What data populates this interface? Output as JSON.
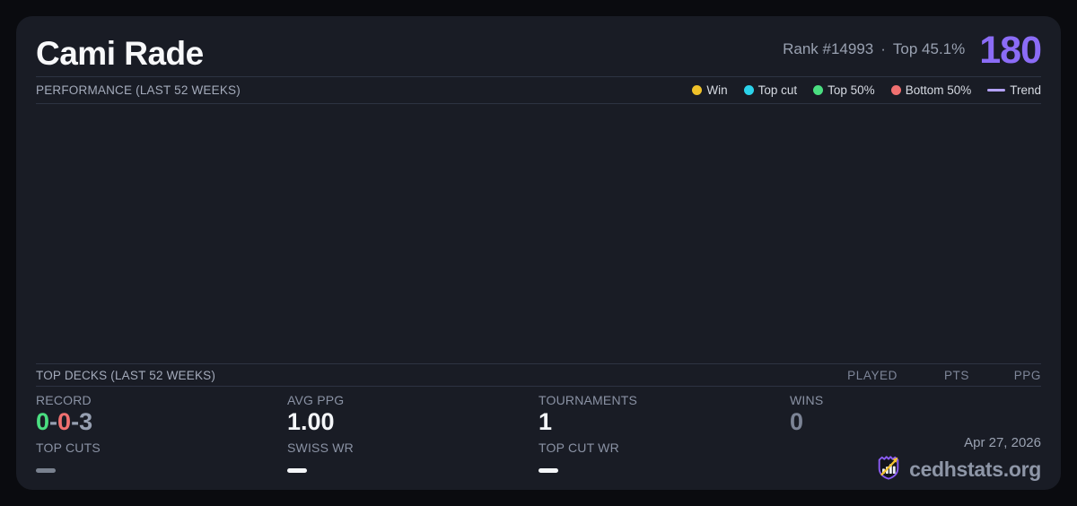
{
  "theme": {
    "page_bg": "#0a0b0f",
    "card_bg": "#191c25",
    "divider": "#2d3342",
    "accent_purple": "#8b6cf6",
    "win_green": "#4ade80",
    "loss_red": "#f07070",
    "muted_gray": "#8a92a4"
  },
  "header": {
    "player_name": "Cami Rade",
    "rank_label": "Rank #14993",
    "separator": "·",
    "top_percent": "Top 45.1%",
    "rating": "180"
  },
  "performance": {
    "section_title": "PERFORMANCE (LAST 52 WEEKS)",
    "legend": [
      {
        "label": "Win",
        "color": "#efc129",
        "swatch": "dot"
      },
      {
        "label": "Top cut",
        "color": "#2bd2ea",
        "swatch": "dot"
      },
      {
        "label": "Top 50%",
        "color": "#4ade80",
        "swatch": "dot"
      },
      {
        "label": "Bottom 50%",
        "color": "#f07070",
        "swatch": "dot"
      },
      {
        "label": "Trend",
        "color": "#b3a1f8",
        "swatch": "line"
      }
    ]
  },
  "chart_data": {
    "type": "scatter",
    "title": "PERFORMANCE (LAST 52 WEEKS)",
    "x": [],
    "series": [],
    "legend_entries": [
      "Win",
      "Top cut",
      "Top 50%",
      "Bottom 50%",
      "Trend"
    ],
    "note": "plot area is rendered empty - no data points, gridlines or axes visible"
  },
  "top_decks": {
    "section_title": "TOP DECKS (LAST 52 WEEKS)",
    "columns": [
      "PLAYED",
      "PTS",
      "PPG"
    ],
    "rows": []
  },
  "stats": {
    "record": {
      "label": "RECORD",
      "wins": "0",
      "sep1": "-",
      "losses": "0",
      "sep2": "-",
      "draws": "3"
    },
    "avg_ppg": {
      "label": "AVG PPG",
      "value": "1.00"
    },
    "tournaments": {
      "label": "TOURNAMENTS",
      "value": "1"
    },
    "wins": {
      "label": "WINS",
      "value": "0"
    },
    "top_cuts": {
      "label": "TOP CUTS",
      "placeholder": "—"
    },
    "swiss_wr": {
      "label": "SWISS WR",
      "placeholder": "—"
    },
    "top_cut_wr": {
      "label": "TOP CUT WR",
      "placeholder": "—"
    }
  },
  "footer": {
    "date": "Apr 27, 2026",
    "brand": "cedhstats.org"
  }
}
